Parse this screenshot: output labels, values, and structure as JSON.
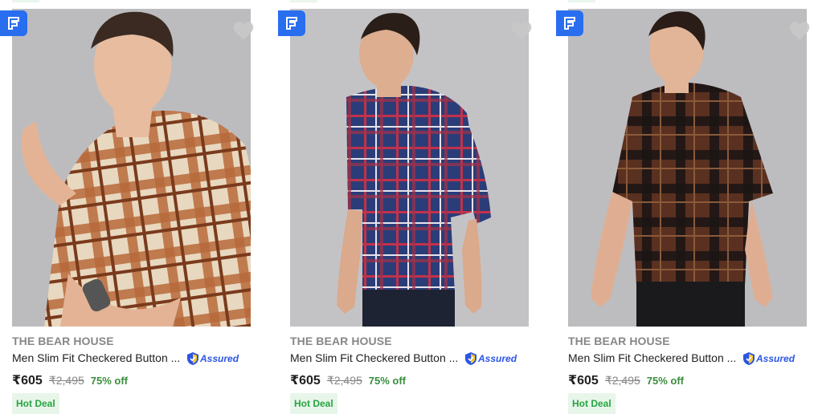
{
  "colors": {
    "badge": "#2a6ef0",
    "assured": "#2a55e5",
    "discount": "#388e3c",
    "deal_bg": "#e8f6ea",
    "deal_text": "#26a541"
  },
  "icons": [
    "f-badge-icon",
    "heart-icon",
    "assured-shield-icon"
  ],
  "products": [
    {
      "brand": "THE BEAR HOUSE",
      "title": "Men Slim Fit Checkered Button ...",
      "assured_label": "Assured",
      "price": "₹605",
      "mrp": "₹2,495",
      "discount": "75% off",
      "tag": "Hot Deal",
      "shirt_colors": [
        "#e8d8bf",
        "#b86a3b",
        "#7a3a1c"
      ]
    },
    {
      "brand": "THE BEAR HOUSE",
      "title": "Men Slim Fit Checkered Button ...",
      "assured_label": "Assured",
      "price": "₹605",
      "mrp": "₹2,495",
      "discount": "75% off",
      "tag": "Hot Deal",
      "shirt_colors": [
        "#2b3d78",
        "#c2324a",
        "#e7e3ea"
      ]
    },
    {
      "brand": "THE BEAR HOUSE",
      "title": "Men Slim Fit Checkered Button ...",
      "assured_label": "Assured",
      "price": "₹605",
      "mrp": "₹2,495",
      "discount": "75% off",
      "tag": "Hot Deal",
      "shirt_colors": [
        "#5a3020",
        "#1a1414",
        "#8a5a3a"
      ]
    }
  ]
}
